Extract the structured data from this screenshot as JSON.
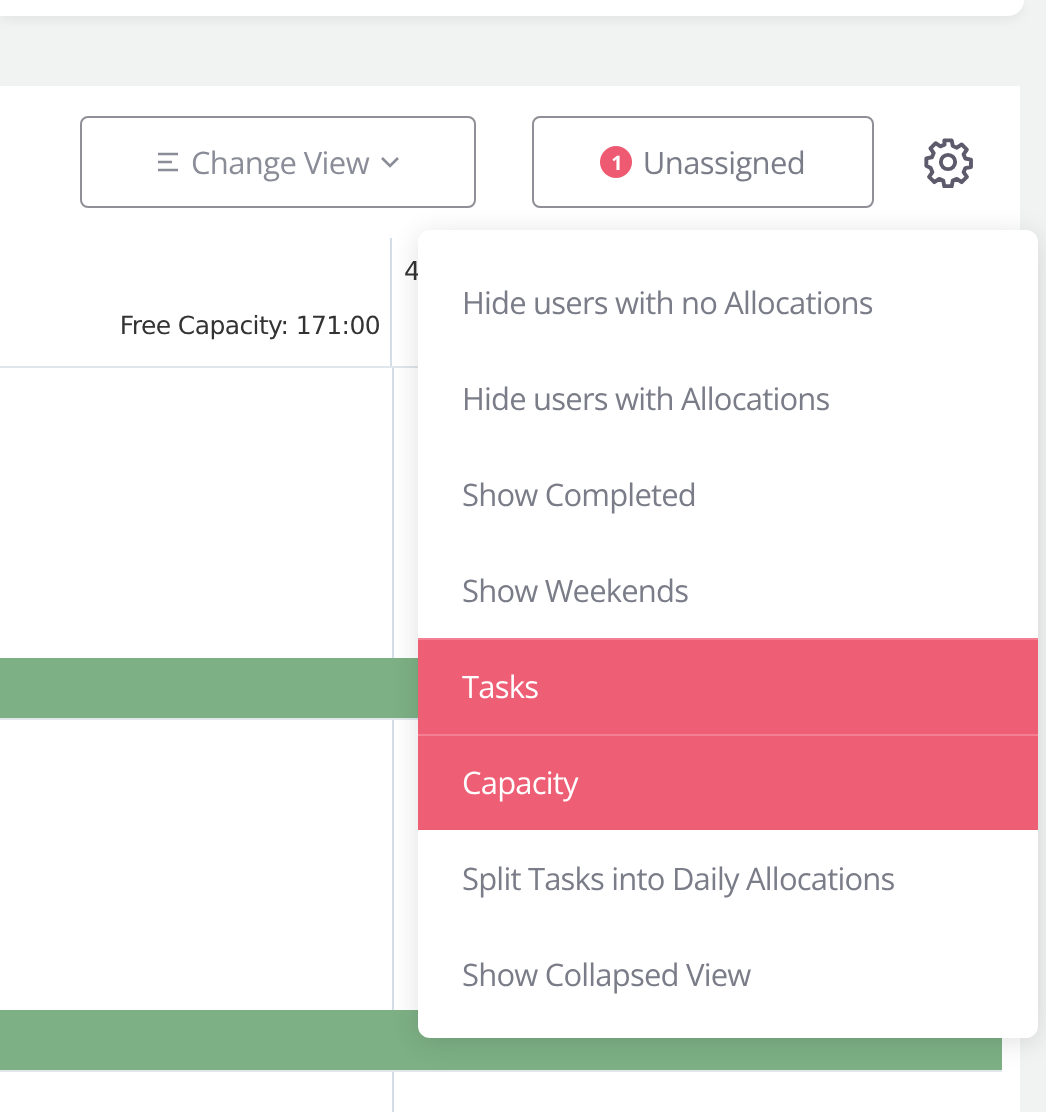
{
  "toolbar": {
    "change_view": "Change View",
    "unassigned": {
      "label": "Unassigned",
      "count": "1"
    }
  },
  "header": {
    "column_1": {
      "free_capacity": "Free Capacity: 171:00"
    },
    "column_2": {
      "value": "4"
    }
  },
  "rows": [
    {
      "kind": "blank"
    },
    {
      "kind": "bar",
      "color": "#7db085"
    },
    {
      "kind": "blank"
    },
    {
      "kind": "bar",
      "color": "#7db085"
    },
    {
      "kind": "blank"
    }
  ],
  "menu": [
    {
      "label": "Hide users with no Allocations",
      "selected": false
    },
    {
      "label": "Hide users with Allocations",
      "selected": false
    },
    {
      "label": "Show Completed",
      "selected": false
    },
    {
      "label": "Show Weekends",
      "selected": false
    },
    {
      "label": "Tasks",
      "selected": true
    },
    {
      "label": "Capacity",
      "selected": true
    },
    {
      "label": "Split Tasks into Daily Allocations",
      "selected": false
    },
    {
      "label": "Show Collapsed View",
      "selected": false
    }
  ]
}
